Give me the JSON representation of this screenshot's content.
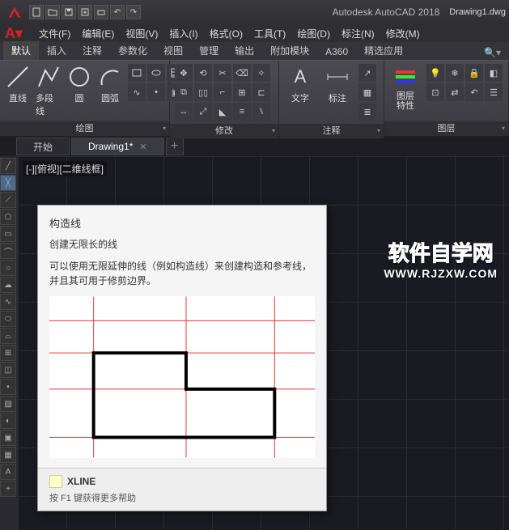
{
  "titlebar": {
    "app": "Autodesk AutoCAD 2018",
    "drawing": "Drawing1.dwg"
  },
  "menu": [
    "文件(F)",
    "编辑(E)",
    "视图(V)",
    "插入(I)",
    "格式(O)",
    "工具(T)",
    "绘图(D)",
    "标注(N)",
    "修改(M)"
  ],
  "ribbon_tabs": [
    "默认",
    "插入",
    "注释",
    "参数化",
    "视图",
    "管理",
    "输出",
    "附加模块",
    "A360",
    "精选应用"
  ],
  "ribbon_active": 0,
  "panels": {
    "draw": {
      "title": "绘图",
      "btns": [
        "直线",
        "多段线",
        "圆",
        "圆弧"
      ]
    },
    "modify": {
      "title": "修改"
    },
    "annot": {
      "title": "注释",
      "btns": [
        "文字",
        "标注"
      ]
    },
    "layer": {
      "title": "图层",
      "btn": "图层\n特性"
    }
  },
  "filetabs": {
    "start": "开始",
    "active": "Drawing1*"
  },
  "view_label": "[-][俯视][二维线框]",
  "tooltip": {
    "title": "构造线",
    "subtitle": "创建无限长的线",
    "desc": "可以使用无限延伸的线（例如构造线）来创建构造和参考线，并且其可用于修剪边界。",
    "cmd": "XLINE",
    "help": "按 F1 键获得更多帮助"
  },
  "watermark": {
    "line1": "软件自学网",
    "line2": "WWW.RJZXW.COM"
  }
}
